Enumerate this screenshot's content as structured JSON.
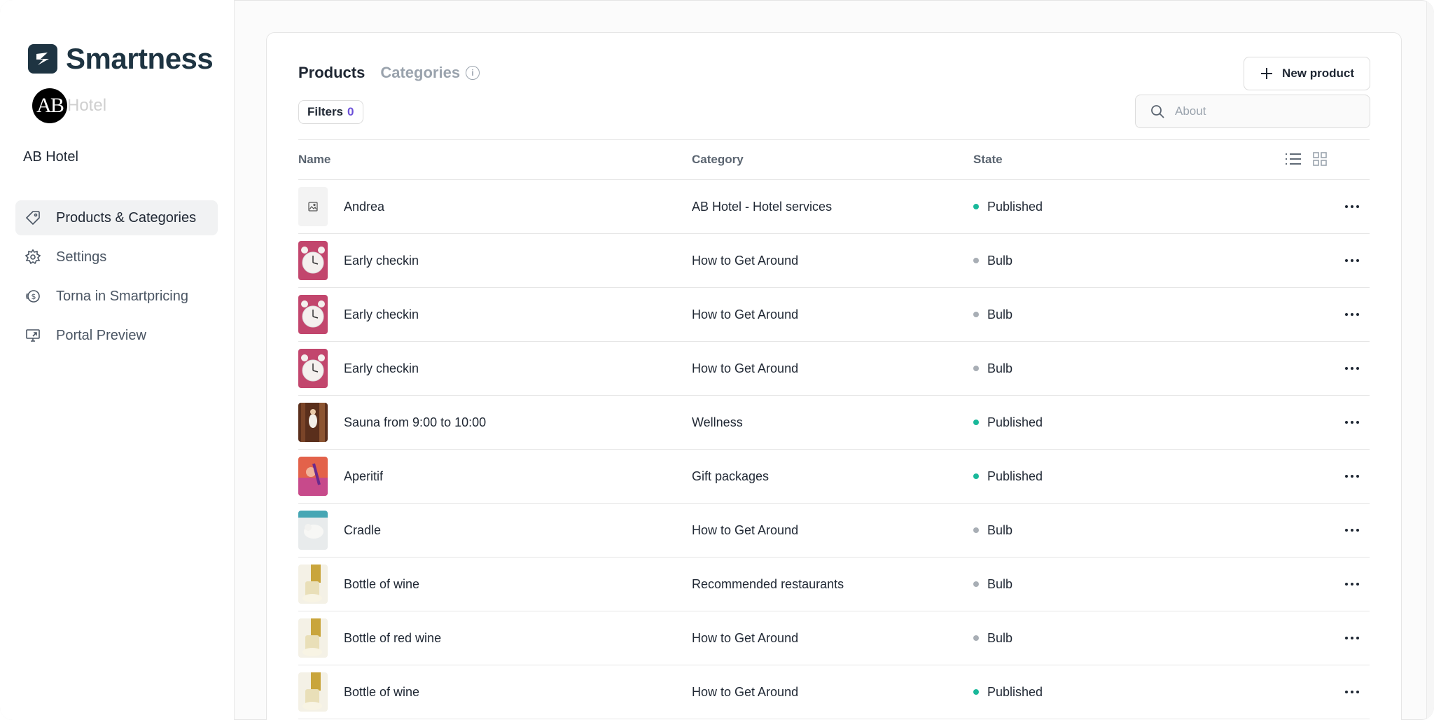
{
  "brand": {
    "name": "Smartness",
    "hotel_logo_mark": "AB",
    "hotel_logo_word": "Hotel"
  },
  "property": {
    "name": "AB Hotel"
  },
  "sidebar": {
    "items": [
      {
        "label": "Products & Categories",
        "icon": "tag-icon",
        "active": true
      },
      {
        "label": "Settings",
        "icon": "gear-icon",
        "active": false
      },
      {
        "label": "Torna in Smartpricing",
        "icon": "dollar-circle-icon",
        "active": false
      },
      {
        "label": "Portal Preview",
        "icon": "monitor-icon",
        "active": false
      }
    ]
  },
  "header": {
    "tabs": [
      {
        "label": "Products"
      },
      {
        "label": "Categories"
      }
    ],
    "new_button_label": "New product",
    "filters_label": "Filters",
    "filters_count": "0",
    "search_placeholder": "About"
  },
  "table": {
    "columns": [
      "Name",
      "Category",
      "State"
    ],
    "rows": [
      {
        "name": "Andrea",
        "category": "AB Hotel - Hotel services",
        "state": "Published",
        "thumb": "placeholder"
      },
      {
        "name": "Early checkin",
        "category": "How to Get Around",
        "state": "Bulb",
        "thumb": "clock"
      },
      {
        "name": "Early checkin",
        "category": "How to Get Around",
        "state": "Bulb",
        "thumb": "clock"
      },
      {
        "name": "Early checkin",
        "category": "How to Get Around",
        "state": "Bulb",
        "thumb": "clock"
      },
      {
        "name": "Sauna from 9:00 to 10:00",
        "category": "Wellness",
        "state": "Published",
        "thumb": "sauna"
      },
      {
        "name": "Aperitif",
        "category": "Gift packages",
        "state": "Published",
        "thumb": "aperitif"
      },
      {
        "name": "Cradle",
        "category": "How to Get Around",
        "state": "Bulb",
        "thumb": "cradle"
      },
      {
        "name": "Bottle of wine",
        "category": "Recommended restaurants",
        "state": "Bulb",
        "thumb": "wine"
      },
      {
        "name": "Bottle of red wine",
        "category": "How to Get Around",
        "state": "Bulb",
        "thumb": "wine"
      },
      {
        "name": "Bottle of wine",
        "category": "How to Get Around",
        "state": "Published",
        "thumb": "wine"
      }
    ]
  },
  "colors": {
    "published": "#19b89a",
    "bulb": "#a8aeb5",
    "brand": "#1e3442",
    "filter_count": "#6b4fd8"
  }
}
